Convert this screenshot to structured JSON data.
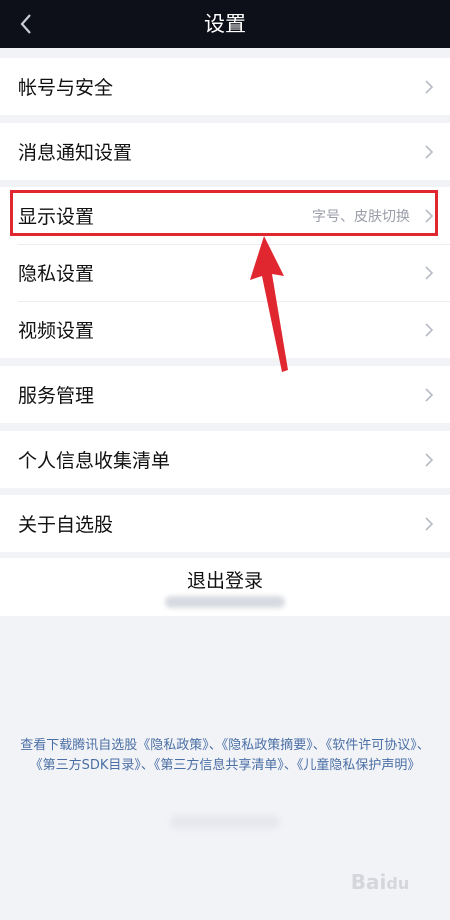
{
  "header": {
    "title": "设置"
  },
  "groups": [
    {
      "items": [
        {
          "label": "帐号与安全"
        }
      ]
    },
    {
      "items": [
        {
          "label": "消息通知设置"
        }
      ]
    },
    {
      "items": [
        {
          "label": "显示设置",
          "hint": "字号、皮肤切换"
        },
        {
          "label": "隐私设置"
        },
        {
          "label": "视频设置"
        }
      ]
    },
    {
      "items": [
        {
          "label": "服务管理"
        }
      ]
    },
    {
      "items": [
        {
          "label": "个人信息收集清单"
        }
      ]
    },
    {
      "items": [
        {
          "label": "关于自选股"
        }
      ]
    }
  ],
  "logout": {
    "label": "退出登录"
  },
  "policy": {
    "text": "查看下载腾讯自选股《隐私政策》、《隐私政策摘要》、《软件许可协议》、《第三方SDK目录》、《第三方信息共享清单》、《儿童隐私保护声明》"
  },
  "colors": {
    "header_bg": "#0d1018",
    "highlight": "#e0262f",
    "link": "#4a6fa5",
    "page_bg": "#f2f3f7"
  }
}
